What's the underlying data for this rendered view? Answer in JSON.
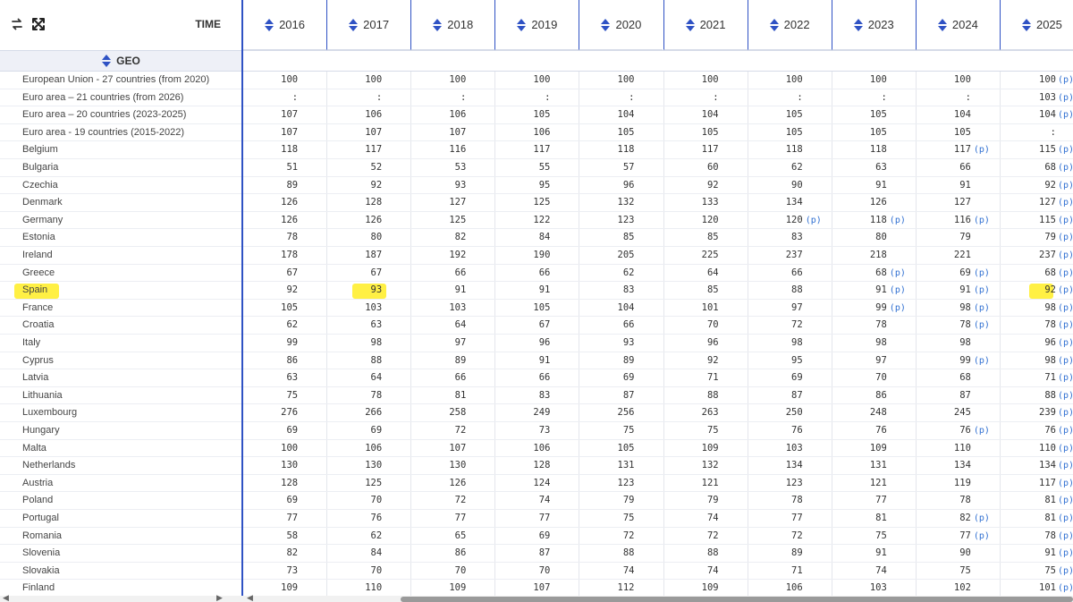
{
  "toolbar": {
    "swap_icon": "swap-arrows-icon",
    "expand_icon": "expand-arrows-icon",
    "time_label": "TIME",
    "geo_label": "GEO"
  },
  "colors": {
    "accent": "#2f52c4",
    "flag": "#2f6fd1",
    "highlight": "#ffef3a"
  },
  "years": [
    "2016",
    "2017",
    "2018",
    "2019",
    "2020",
    "2021",
    "2022",
    "2023",
    "2024",
    "2025"
  ],
  "rows": [
    {
      "geo": "European Union - 27 countries (from 2020)",
      "values": [
        "100",
        "100",
        "100",
        "100",
        "100",
        "100",
        "100",
        "100",
        "100",
        "100"
      ],
      "flags": [
        "",
        "",
        "",
        "",
        "",
        "",
        "",
        "",
        "",
        "(p)"
      ]
    },
    {
      "geo": "Euro area – 21 countries (from 2026)",
      "values": [
        ":",
        ":",
        ":",
        ":",
        ":",
        ":",
        ":",
        ":",
        ":",
        "103"
      ],
      "flags": [
        "",
        "",
        "",
        "",
        "",
        "",
        "",
        "",
        "",
        "(p)"
      ]
    },
    {
      "geo": "Euro area – 20 countries (2023-2025)",
      "values": [
        "107",
        "106",
        "106",
        "105",
        "104",
        "104",
        "105",
        "105",
        "104",
        "104"
      ],
      "flags": [
        "",
        "",
        "",
        "",
        "",
        "",
        "",
        "",
        "",
        "(p)"
      ]
    },
    {
      "geo": "Euro area - 19 countries (2015-2022)",
      "values": [
        "107",
        "107",
        "107",
        "106",
        "105",
        "105",
        "105",
        "105",
        "105",
        ":"
      ],
      "flags": [
        "",
        "",
        "",
        "",
        "",
        "",
        "",
        "",
        "",
        ""
      ]
    },
    {
      "geo": "Belgium",
      "values": [
        "118",
        "117",
        "116",
        "117",
        "118",
        "117",
        "118",
        "118",
        "117",
        "115"
      ],
      "flags": [
        "",
        "",
        "",
        "",
        "",
        "",
        "",
        "",
        "(p)",
        "(p)"
      ]
    },
    {
      "geo": "Bulgaria",
      "values": [
        "51",
        "52",
        "53",
        "55",
        "57",
        "60",
        "62",
        "63",
        "66",
        "68"
      ],
      "flags": [
        "",
        "",
        "",
        "",
        "",
        "",
        "",
        "",
        "",
        "(p)"
      ]
    },
    {
      "geo": "Czechia",
      "values": [
        "89",
        "92",
        "93",
        "95",
        "96",
        "92",
        "90",
        "91",
        "91",
        "92"
      ],
      "flags": [
        "",
        "",
        "",
        "",
        "",
        "",
        "",
        "",
        "",
        "(p)"
      ]
    },
    {
      "geo": "Denmark",
      "values": [
        "126",
        "128",
        "127",
        "125",
        "132",
        "133",
        "134",
        "126",
        "127",
        "127"
      ],
      "flags": [
        "",
        "",
        "",
        "",
        "",
        "",
        "",
        "",
        "",
        "(p)"
      ]
    },
    {
      "geo": "Germany",
      "values": [
        "126",
        "126",
        "125",
        "122",
        "123",
        "120",
        "120",
        "118",
        "116",
        "115"
      ],
      "flags": [
        "",
        "",
        "",
        "",
        "",
        "",
        "(p)",
        "(p)",
        "(p)",
        "(p)"
      ]
    },
    {
      "geo": "Estonia",
      "values": [
        "78",
        "80",
        "82",
        "84",
        "85",
        "85",
        "83",
        "80",
        "79",
        "79"
      ],
      "flags": [
        "",
        "",
        "",
        "",
        "",
        "",
        "",
        "",
        "",
        "(p)"
      ]
    },
    {
      "geo": "Ireland",
      "values": [
        "178",
        "187",
        "192",
        "190",
        "205",
        "225",
        "237",
        "218",
        "221",
        "237"
      ],
      "flags": [
        "",
        "",
        "",
        "",
        "",
        "",
        "",
        "",
        "",
        "(p)"
      ]
    },
    {
      "geo": "Greece",
      "values": [
        "67",
        "67",
        "66",
        "66",
        "62",
        "64",
        "66",
        "68",
        "69",
        "68"
      ],
      "flags": [
        "",
        "",
        "",
        "",
        "",
        "",
        "",
        "(p)",
        "(p)",
        "(p)"
      ]
    },
    {
      "geo": "Spain",
      "values": [
        "92",
        "93",
        "91",
        "91",
        "83",
        "85",
        "88",
        "91",
        "91",
        "92"
      ],
      "flags": [
        "",
        "",
        "",
        "",
        "",
        "",
        "",
        "(p)",
        "(p)",
        "(p)"
      ]
    },
    {
      "geo": "France",
      "values": [
        "105",
        "103",
        "103",
        "105",
        "104",
        "101",
        "97",
        "99",
        "98",
        "98"
      ],
      "flags": [
        "",
        "",
        "",
        "",
        "",
        "",
        "",
        "(p)",
        "(p)",
        "(p)"
      ]
    },
    {
      "geo": "Croatia",
      "values": [
        "62",
        "63",
        "64",
        "67",
        "66",
        "70",
        "72",
        "78",
        "78",
        "78"
      ],
      "flags": [
        "",
        "",
        "",
        "",
        "",
        "",
        "",
        "",
        "(p)",
        "(p)"
      ]
    },
    {
      "geo": "Italy",
      "values": [
        "99",
        "98",
        "97",
        "96",
        "93",
        "96",
        "98",
        "98",
        "98",
        "96"
      ],
      "flags": [
        "",
        "",
        "",
        "",
        "",
        "",
        "",
        "",
        "",
        "(p)"
      ]
    },
    {
      "geo": "Cyprus",
      "values": [
        "86",
        "88",
        "89",
        "91",
        "89",
        "92",
        "95",
        "97",
        "99",
        "98"
      ],
      "flags": [
        "",
        "",
        "",
        "",
        "",
        "",
        "",
        "",
        "(p)",
        "(p)"
      ]
    },
    {
      "geo": "Latvia",
      "values": [
        "63",
        "64",
        "66",
        "66",
        "69",
        "71",
        "69",
        "70",
        "68",
        "71"
      ],
      "flags": [
        "",
        "",
        "",
        "",
        "",
        "",
        "",
        "",
        "",
        "(p)"
      ]
    },
    {
      "geo": "Lithuania",
      "values": [
        "75",
        "78",
        "81",
        "83",
        "87",
        "88",
        "87",
        "86",
        "87",
        "88"
      ],
      "flags": [
        "",
        "",
        "",
        "",
        "",
        "",
        "",
        "",
        "",
        "(p)"
      ]
    },
    {
      "geo": "Luxembourg",
      "values": [
        "276",
        "266",
        "258",
        "249",
        "256",
        "263",
        "250",
        "248",
        "245",
        "239"
      ],
      "flags": [
        "",
        "",
        "",
        "",
        "",
        "",
        "",
        "",
        "",
        "(p)"
      ]
    },
    {
      "geo": "Hungary",
      "values": [
        "69",
        "69",
        "72",
        "73",
        "75",
        "75",
        "76",
        "76",
        "76",
        "76"
      ],
      "flags": [
        "",
        "",
        "",
        "",
        "",
        "",
        "",
        "",
        "(p)",
        "(p)"
      ]
    },
    {
      "geo": "Malta",
      "values": [
        "100",
        "106",
        "107",
        "106",
        "105",
        "109",
        "103",
        "109",
        "110",
        "110"
      ],
      "flags": [
        "",
        "",
        "",
        "",
        "",
        "",
        "",
        "",
        "",
        "(p)"
      ]
    },
    {
      "geo": "Netherlands",
      "values": [
        "130",
        "130",
        "130",
        "128",
        "131",
        "132",
        "134",
        "131",
        "134",
        "134"
      ],
      "flags": [
        "",
        "",
        "",
        "",
        "",
        "",
        "",
        "",
        "",
        "(p)"
      ]
    },
    {
      "geo": "Austria",
      "values": [
        "128",
        "125",
        "126",
        "124",
        "123",
        "121",
        "123",
        "121",
        "119",
        "117"
      ],
      "flags": [
        "",
        "",
        "",
        "",
        "",
        "",
        "",
        "",
        "",
        "(p)"
      ]
    },
    {
      "geo": "Poland",
      "values": [
        "69",
        "70",
        "72",
        "74",
        "79",
        "79",
        "78",
        "77",
        "78",
        "81"
      ],
      "flags": [
        "",
        "",
        "",
        "",
        "",
        "",
        "",
        "",
        "",
        "(p)"
      ]
    },
    {
      "geo": "Portugal",
      "values": [
        "77",
        "76",
        "77",
        "77",
        "75",
        "74",
        "77",
        "81",
        "82",
        "81"
      ],
      "flags": [
        "",
        "",
        "",
        "",
        "",
        "",
        "",
        "",
        "(p)",
        "(p)"
      ]
    },
    {
      "geo": "Romania",
      "values": [
        "58",
        "62",
        "65",
        "69",
        "72",
        "72",
        "72",
        "75",
        "77",
        "78"
      ],
      "flags": [
        "",
        "",
        "",
        "",
        "",
        "",
        "",
        "",
        "(p)",
        "(p)"
      ]
    },
    {
      "geo": "Slovenia",
      "values": [
        "82",
        "84",
        "86",
        "87",
        "88",
        "88",
        "89",
        "91",
        "90",
        "91"
      ],
      "flags": [
        "",
        "",
        "",
        "",
        "",
        "",
        "",
        "",
        "",
        "(p)"
      ]
    },
    {
      "geo": "Slovakia",
      "values": [
        "73",
        "70",
        "70",
        "70",
        "74",
        "74",
        "71",
        "74",
        "75",
        "75"
      ],
      "flags": [
        "",
        "",
        "",
        "",
        "",
        "",
        "",
        "",
        "",
        "(p)"
      ]
    },
    {
      "geo": "Finland",
      "values": [
        "109",
        "110",
        "109",
        "107",
        "112",
        "109",
        "106",
        "103",
        "102",
        "101"
      ],
      "flags": [
        "",
        "",
        "",
        "",
        "",
        "",
        "",
        "",
        "",
        "(p)"
      ]
    }
  ],
  "highlights": [
    {
      "row": "Spain",
      "column": "GEO"
    },
    {
      "row": "Spain",
      "column": "2017"
    },
    {
      "row": "Spain",
      "column": "2025"
    }
  ]
}
